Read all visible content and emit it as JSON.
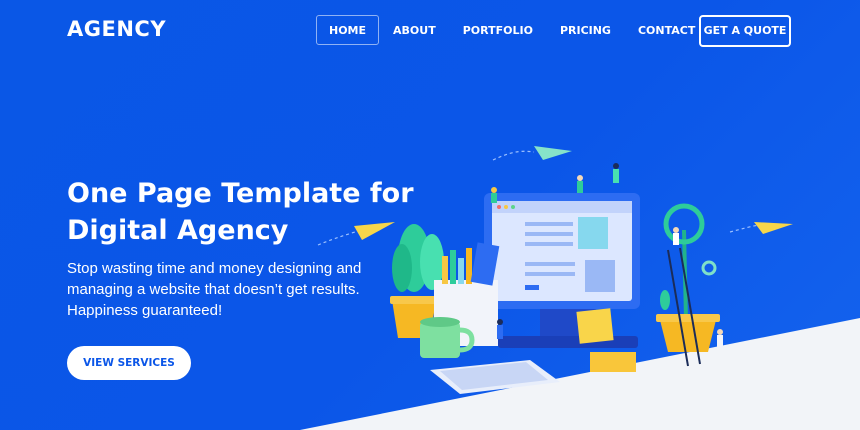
{
  "header": {
    "brand": "AGENCY",
    "nav": [
      "HOME",
      "ABOUT",
      "PORTFOLIO",
      "PRICING",
      "CONTACT"
    ],
    "active_nav": "HOME",
    "cta": "GET A QUOTE"
  },
  "hero": {
    "title_line1": "One Page Template for",
    "title_line2": "Digital Agency",
    "subtitle_line1": "Stop wasting time and money designing and",
    "subtitle_line2": "managing a website that doesn’t get results.",
    "subtitle_line3": "Happiness guaranteed!",
    "button": "VIEW SERVICES"
  },
  "colors": {
    "primary": "#0b56e8",
    "accent_yellow": "#f7c744",
    "accent_teal": "#7ee0c8",
    "light": "#f3f5f9"
  },
  "icons": [
    "paper-plane-icon",
    "monitor-illustration",
    "plant-illustration",
    "mug-illustration",
    "keyboard-illustration"
  ]
}
